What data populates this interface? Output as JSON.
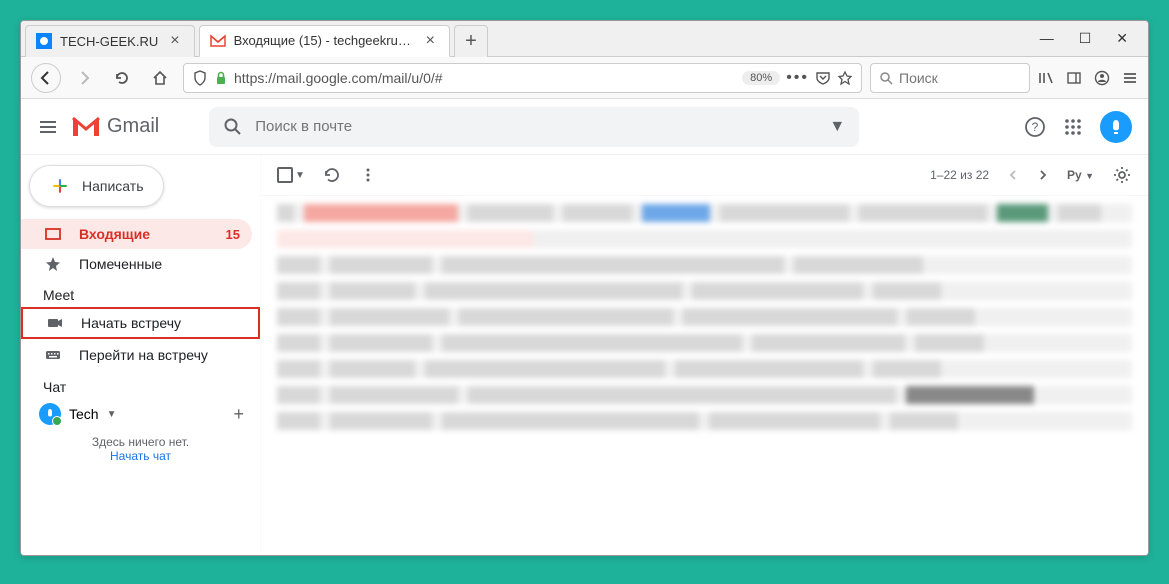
{
  "tabs": [
    {
      "title": "TECH-GEEK.RU",
      "active": false
    },
    {
      "title": "Входящие (15) - techgeekru@g",
      "active": true
    }
  ],
  "url": {
    "display": "https://mail.google.com/mail/u/0/#",
    "zoom": "80%"
  },
  "browser_search": {
    "placeholder": "Поиск"
  },
  "gmail": {
    "brand": "Gmail",
    "search_placeholder": "Поиск в почте",
    "compose": "Написать",
    "sidebar": {
      "inbox": {
        "label": "Входящие",
        "count": "15"
      },
      "starred": {
        "label": "Помеченные"
      }
    },
    "meet": {
      "header": "Meet",
      "start": "Начать встречу",
      "join": "Перейти на встречу"
    },
    "chat": {
      "header": "Чат",
      "username": "Tech",
      "empty": "Здесь ничего нет.",
      "start": "Начать чат"
    },
    "toolbar": {
      "pagination": "1–22 из 22",
      "lang": "Ру"
    }
  }
}
